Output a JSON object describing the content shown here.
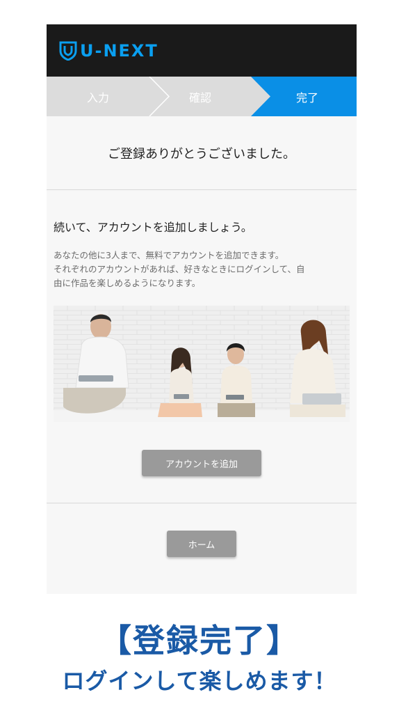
{
  "header": {
    "logo_text": "U-NEXT"
  },
  "steps": [
    {
      "label": "入力",
      "active": false
    },
    {
      "label": "確認",
      "active": false
    },
    {
      "label": "完了",
      "active": true
    }
  ],
  "colors": {
    "accent": "#0a8fe6",
    "step_inactive": "#dcdcdc",
    "button": "#9a9a9a",
    "caption": "#1a5aa6"
  },
  "main": {
    "thanks": "ご登録ありがとうございました。",
    "headline": "続いて、アカウントを追加しましょう。",
    "desc_line1": "あなたの他に3人まで、無料でアカウントを追加できます。",
    "desc_line2": "それぞれのアカウントがあれば、好きなときにログインして、自",
    "desc_line3": "由に作品を楽しめるようになります。",
    "add_account_button": "アカウントを追加",
    "home_button": "ホーム"
  },
  "caption": {
    "line1": "【登録完了】",
    "line2": "ログインして楽しめます！"
  }
}
